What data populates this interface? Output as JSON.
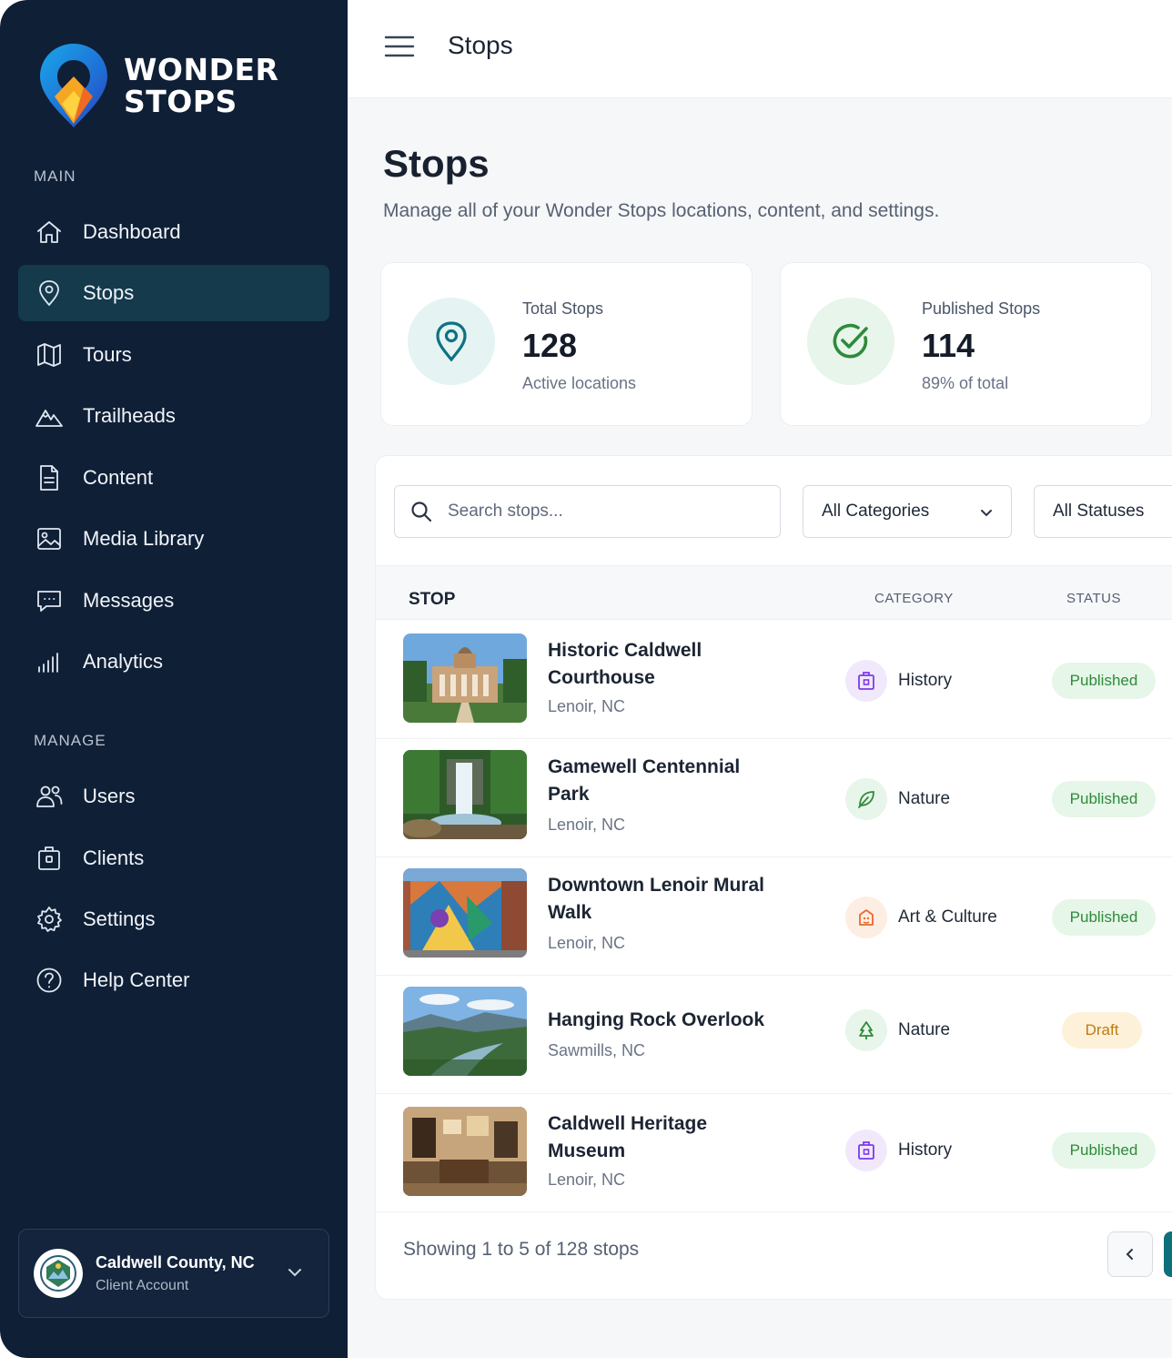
{
  "brand": {
    "name_line1": "WONDER",
    "name_line2": "STOPS"
  },
  "topbar": {
    "title": "Stops"
  },
  "sidebar": {
    "section_main": "MAIN",
    "main_items": [
      {
        "label": "Dashboard",
        "icon": "home-icon"
      },
      {
        "label": "Stops",
        "icon": "map-pin-icon",
        "active": true
      },
      {
        "label": "Tours",
        "icon": "map-icon"
      },
      {
        "label": "Trailheads",
        "icon": "mountain-icon"
      },
      {
        "label": "Content",
        "icon": "document-icon"
      },
      {
        "label": "Media Library",
        "icon": "image-icon"
      },
      {
        "label": "Messages",
        "icon": "message-icon"
      },
      {
        "label": "Analytics",
        "icon": "bar-chart-icon"
      }
    ],
    "section_manage": "MANAGE",
    "manage_items": [
      {
        "label": "Users",
        "icon": "users-icon"
      },
      {
        "label": "Clients",
        "icon": "briefcase-icon"
      },
      {
        "label": "Settings",
        "icon": "gear-icon"
      },
      {
        "label": "Help Center",
        "icon": "help-icon"
      }
    ],
    "account": {
      "name": "Caldwell County, NC",
      "type": "Client Account"
    }
  },
  "page": {
    "title": "Stops",
    "subtitle": "Manage all of your Wonder Stops locations, content, and settings."
  },
  "stats": [
    {
      "label": "Total Stops",
      "value": "128",
      "note": "Active locations",
      "icon": "map-pin-icon",
      "color": "#0e7281"
    },
    {
      "label": "Published Stops",
      "value": "114",
      "note": "89% of total",
      "icon": "check-circle-icon",
      "color": "#2e8a3c"
    }
  ],
  "filters": {
    "search_placeholder": "Search stops...",
    "category": "All Categories",
    "status": "All Statuses"
  },
  "table": {
    "headers": {
      "stop": "STOP",
      "category": "CATEGORY",
      "status": "STATUS"
    },
    "rows": [
      {
        "name": "Historic Caldwell Courthouse",
        "location": "Lenoir, NC",
        "category": "History",
        "status": "Published"
      },
      {
        "name": "Gamewell Centennial Park",
        "location": "Lenoir, NC",
        "category": "Nature",
        "status": "Published"
      },
      {
        "name": "Downtown Lenoir Mural Walk",
        "location": "Lenoir, NC",
        "category": "Art & Culture",
        "status": "Published"
      },
      {
        "name": "Hanging Rock Overlook",
        "location": "Sawmills, NC",
        "category": "Nature",
        "status": "Draft"
      },
      {
        "name": "Caldwell Heritage Museum",
        "location": "Lenoir, NC",
        "category": "History",
        "status": "Published"
      }
    ],
    "showing": "Showing 1 to 5 of 128 stops"
  },
  "colors": {
    "sidebar_bg": "#0f1f36",
    "active_bg": "#143a4c",
    "accent": "#0f6f7a",
    "published": "#2f8a3a",
    "draft": "#c07a10",
    "history": "#7c3aed",
    "nature": "#2f8a3a",
    "art": "#ea6a2b"
  }
}
